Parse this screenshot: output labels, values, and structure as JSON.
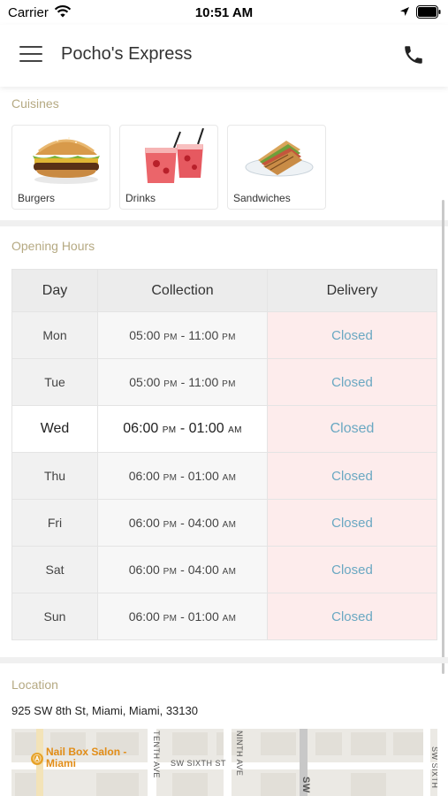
{
  "status_bar": {
    "carrier": "Carrier",
    "time": "10:51 AM"
  },
  "header": {
    "title": "Pocho's Express",
    "menu_icon": "hamburger-menu-icon",
    "phone_icon": "phone-icon"
  },
  "cuisines": {
    "label": "Cuisines",
    "items": [
      {
        "name": "Burgers"
      },
      {
        "name": "Drinks"
      },
      {
        "name": "Sandwiches"
      }
    ]
  },
  "opening_hours": {
    "label": "Opening Hours",
    "columns": [
      "Day",
      "Collection",
      "Delivery"
    ],
    "rows": [
      {
        "day": "Mon",
        "coll_start": "05:00",
        "coll_start_ampm": "PM",
        "coll_end": "11:00",
        "coll_end_ampm": "PM",
        "delivery": "Closed"
      },
      {
        "day": "Tue",
        "coll_start": "05:00",
        "coll_start_ampm": "PM",
        "coll_end": "11:00",
        "coll_end_ampm": "PM",
        "delivery": "Closed"
      },
      {
        "day": "Wed",
        "coll_start": "06:00",
        "coll_start_ampm": "PM",
        "coll_end": "01:00",
        "coll_end_ampm": "AM",
        "delivery": "Closed"
      },
      {
        "day": "Thu",
        "coll_start": "06:00",
        "coll_start_ampm": "PM",
        "coll_end": "01:00",
        "coll_end_ampm": "AM",
        "delivery": "Closed"
      },
      {
        "day": "Fri",
        "coll_start": "06:00",
        "coll_start_ampm": "PM",
        "coll_end": "04:00",
        "coll_end_ampm": "AM",
        "delivery": "Closed"
      },
      {
        "day": "Sat",
        "coll_start": "06:00",
        "coll_start_ampm": "PM",
        "coll_end": "04:00",
        "coll_end_ampm": "AM",
        "delivery": "Closed"
      },
      {
        "day": "Sun",
        "coll_start": "06:00",
        "coll_start_ampm": "PM",
        "coll_end": "01:00",
        "coll_end_ampm": "AM",
        "delivery": "Closed"
      }
    ],
    "highlighted_day": "Wed"
  },
  "location": {
    "label": "Location",
    "address": "925 SW 8th St, Miami, Miami, 33130",
    "map": {
      "poi_name": "Nail Box Salon - Miami",
      "streets": [
        "TENTH AVE",
        "SW SIXTH ST",
        "NINTH AVE",
        "SW",
        "SW SIXTH"
      ]
    }
  },
  "colors": {
    "section_label": "#b5a982",
    "closed_text": "#6aa8c2",
    "closed_bg": "#fdecec",
    "poi": "#e28d17"
  }
}
